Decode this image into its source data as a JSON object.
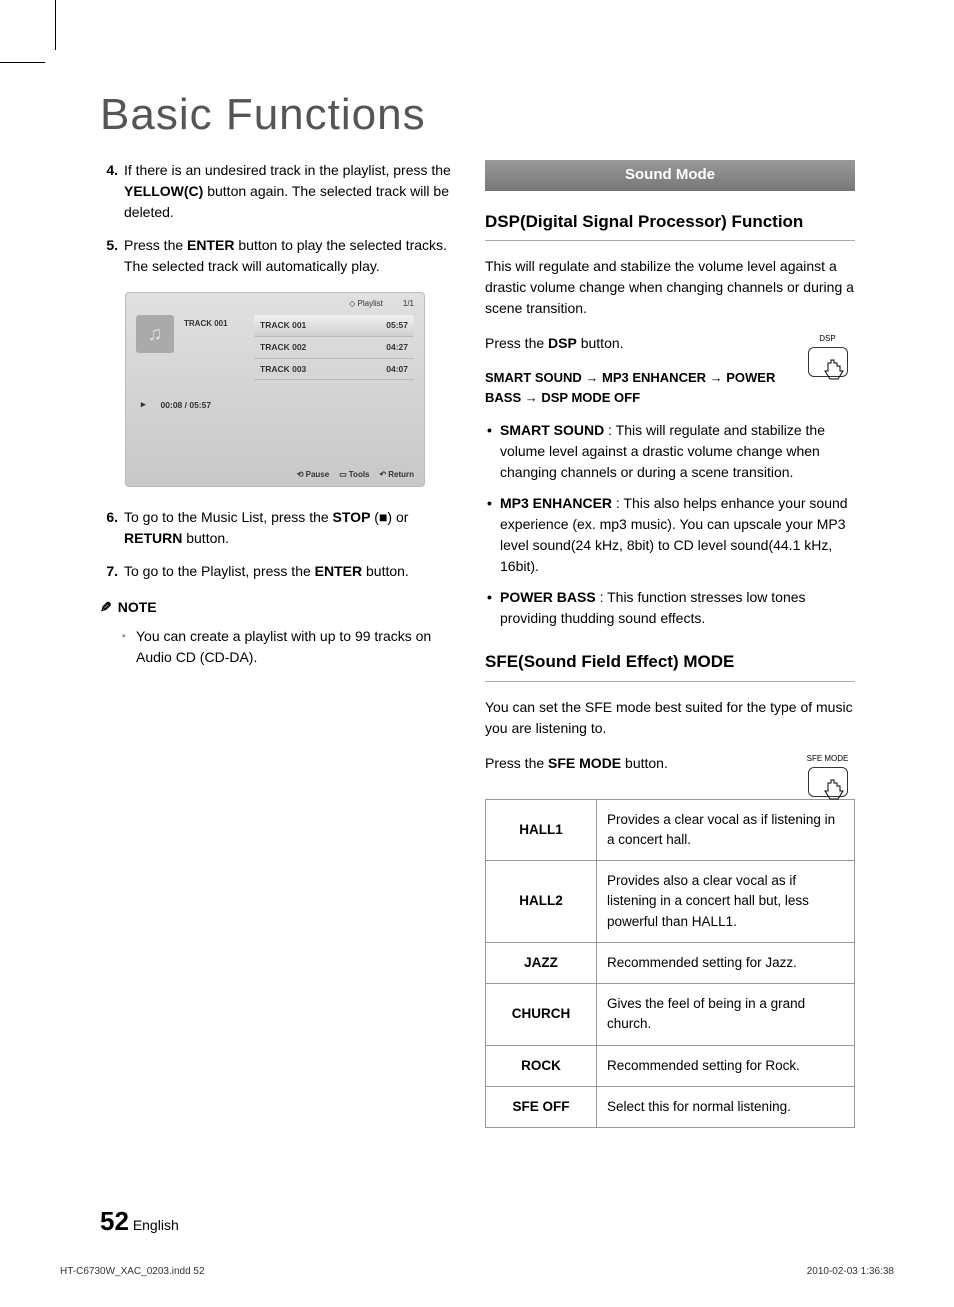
{
  "title": "Basic Functions",
  "left": {
    "steps": [
      {
        "num": "4.",
        "html": "If there is an undesired track in the playlist, press the <b>YELLOW(C)</b> button again. The selected track will be deleted."
      },
      {
        "num": "5.",
        "html": "Press the <b>ENTER</b> button to play the selected tracks. The selected track will automatically play."
      },
      {
        "num": "6.",
        "html": "To go to the Music List, press the <b>STOP</b> (■) or <b>RETURN</b> button."
      },
      {
        "num": "7.",
        "html": "To go to the Playlist, press the <b>ENTER</b> button."
      }
    ],
    "ui": {
      "playlist_label": "Playlist",
      "page_indicator": "1/1",
      "current_track": "TRACK 001",
      "tracks": [
        {
          "name": "TRACK 001",
          "duration": "05:57"
        },
        {
          "name": "TRACK 002",
          "duration": "04:27"
        },
        {
          "name": "TRACK 003",
          "duration": "04:07"
        }
      ],
      "playback_time": "00:08 / 05:57",
      "bottom": {
        "pause": "Pause",
        "tools": "Tools",
        "return": "Return"
      }
    },
    "note_label": "NOTE",
    "note_text": "You can create a playlist with up to 99 tracks on Audio CD (CD-DA)."
  },
  "right": {
    "section_bar": "Sound Mode",
    "dsp": {
      "heading": "DSP(Digital Signal Processor) Function",
      "intro": "This will regulate and stabilize the volume level against a drastic volume change when changing channels or during a scene transition.",
      "press_html": "Press the <b>DSP</b> button.",
      "button_label": "DSP",
      "chain": "SMART SOUND → MP3 ENHANCER → POWER BASS → DSP MODE OFF",
      "bullets": [
        {
          "term": "SMART SOUND",
          "desc": " : This will regulate and stabilize the volume level against a drastic volume change when changing channels or during a scene transition."
        },
        {
          "term": "MP3 ENHANCER",
          "desc": " : This also helps enhance your sound experience (ex. mp3 music). You can upscale your MP3 level sound(24 kHz, 8bit) to CD level sound(44.1 kHz, 16bit)."
        },
        {
          "term": "POWER BASS",
          "desc": " : This function stresses low tones providing thudding sound effects."
        }
      ]
    },
    "sfe": {
      "heading": "SFE(Sound Field Effect) MODE",
      "intro": "You can set the SFE mode best suited for the type of music you are listening to.",
      "press_html": "Press the <b>SFE MODE</b> button.",
      "button_label": "SFE MODE",
      "rows": [
        {
          "mode": "HALL1",
          "desc": "Provides a clear vocal as if listening in a concert hall."
        },
        {
          "mode": "HALL2",
          "desc": "Provides also a clear vocal as if listening in a concert hall but, less powerful than HALL1."
        },
        {
          "mode": "JAZZ",
          "desc": "Recommended setting for Jazz."
        },
        {
          "mode": "CHURCH",
          "desc": "Gives the feel of being in a grand church."
        },
        {
          "mode": "ROCK",
          "desc": "Recommended setting for Rock."
        },
        {
          "mode": "SFE OFF",
          "desc": "Select this for normal listening."
        }
      ]
    }
  },
  "footer": {
    "page": "52",
    "lang": "English",
    "file": "HT-C6730W_XAC_0203.indd   52",
    "timestamp": "2010-02-03   1:36:38"
  }
}
